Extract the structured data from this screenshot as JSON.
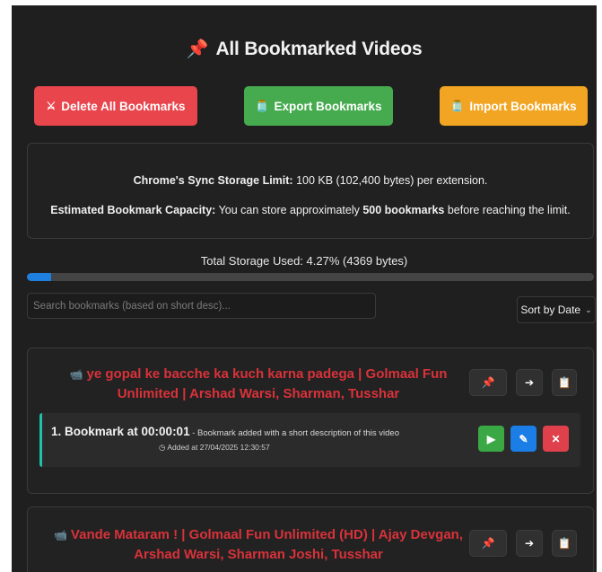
{
  "header": {
    "icon": "pushpin-icon",
    "title": "All Bookmarked Videos"
  },
  "toolbar": {
    "delete_all": {
      "icon": "crossed-swords-icon",
      "label": "Delete All Bookmarks"
    },
    "export": {
      "icon": "jar-icon",
      "label": "Export Bookmarks"
    },
    "import": {
      "icon": "jar-icon",
      "label": "Import Bookmarks"
    }
  },
  "storage_info": {
    "limit_label": "Chrome's Sync Storage Limit:",
    "limit_value": "100 KB (102,400 bytes) per extension.",
    "capacity_label": "Estimated Bookmark Capacity:",
    "capacity_pre": "You can store approximately",
    "capacity_count": "500 bookmarks",
    "capacity_post": "before reaching the limit."
  },
  "usage": {
    "text": "Total Storage Used: 4.27% (4369 bytes)",
    "percent": 4.27
  },
  "search": {
    "placeholder": "Search bookmarks (based on short desc)...",
    "value": ""
  },
  "sort": {
    "selected": "Sort by Date"
  },
  "videos": [
    {
      "icon": "video-icon",
      "title": "ye gopal ke bacche ka kuch karna padega | Golmaal Fun Unlimited | Arshad Warsi, Sharman, Tusshar",
      "bookmarks": [
        {
          "time_label": "1. Bookmark at 00:00:01",
          "description": " - Bookmark added with a short description of this video",
          "added": "Added at 27/04/2025 12:30:57"
        }
      ]
    },
    {
      "icon": "video-icon",
      "title": "Vande Mataram ! | Golmaal Fun Unlimited (HD) | Ajay Devgan, Arshad Warsi, Sharman Joshi, Tusshar",
      "bookmarks": []
    }
  ],
  "colors": {
    "background": "#1f1f1f",
    "delete": "#e8454c",
    "export": "#46ab4f",
    "import": "#f2a523",
    "progress": "#1e7fe0",
    "title_red": "#d9323a",
    "accent_teal": "#1fc3a8"
  }
}
